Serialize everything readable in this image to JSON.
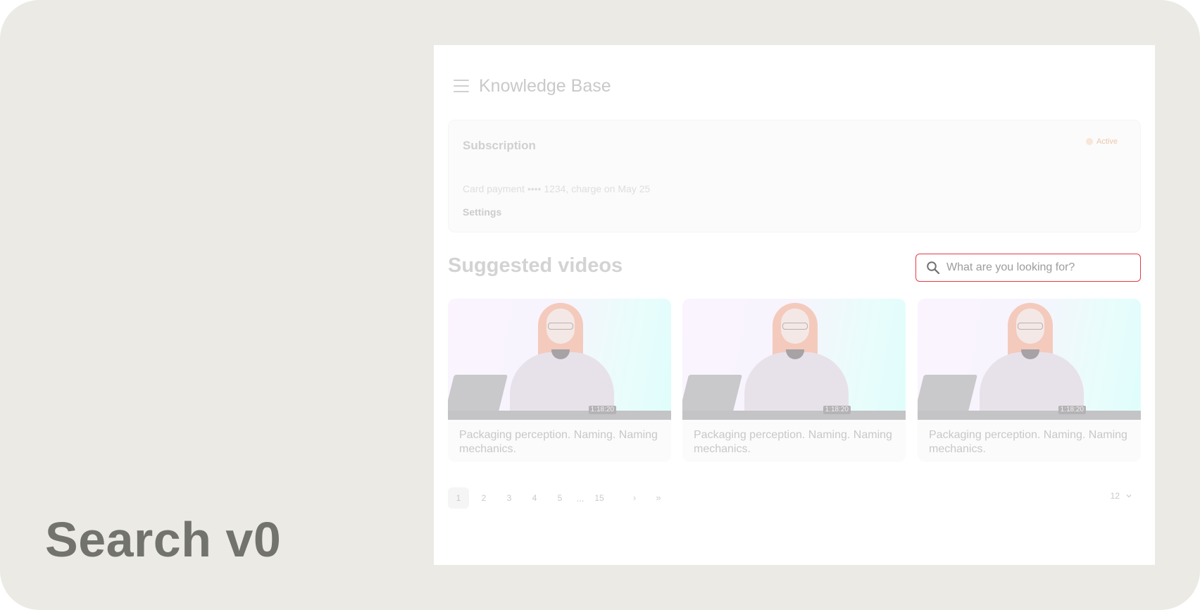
{
  "caption": "Search v0",
  "header": {
    "title": "Knowledge Base"
  },
  "subscription": {
    "title": "Subscription",
    "status": "Active",
    "description": "Card payment •••• 1234, charge on May 25",
    "settings_label": "Settings",
    "status_color": "#f8e6d8"
  },
  "suggested": {
    "title": "Suggested videos",
    "search": {
      "placeholder": "What are you looking for?",
      "value": "",
      "border_color": "#e63a46"
    }
  },
  "videos": [
    {
      "title": "Packaging perception. Naming. Naming mechanics.",
      "duration": "1:18:20"
    },
    {
      "title": "Packaging perception. Naming. Naming mechanics.",
      "duration": "1:18:20"
    },
    {
      "title": "Packaging perception. Naming. Naming mechanics.",
      "duration": "1:18:20"
    }
  ],
  "pagination": {
    "pages": [
      "1",
      "2",
      "3",
      "4",
      "5"
    ],
    "ellipsis": "...",
    "last_page": "15",
    "current": "1",
    "next_icon": "›",
    "last_icon": "»",
    "per_page": "12"
  },
  "icons": {
    "menu": "hamburger-icon",
    "search": "search-icon",
    "per_page_toggle": "chevron-down-icon"
  }
}
